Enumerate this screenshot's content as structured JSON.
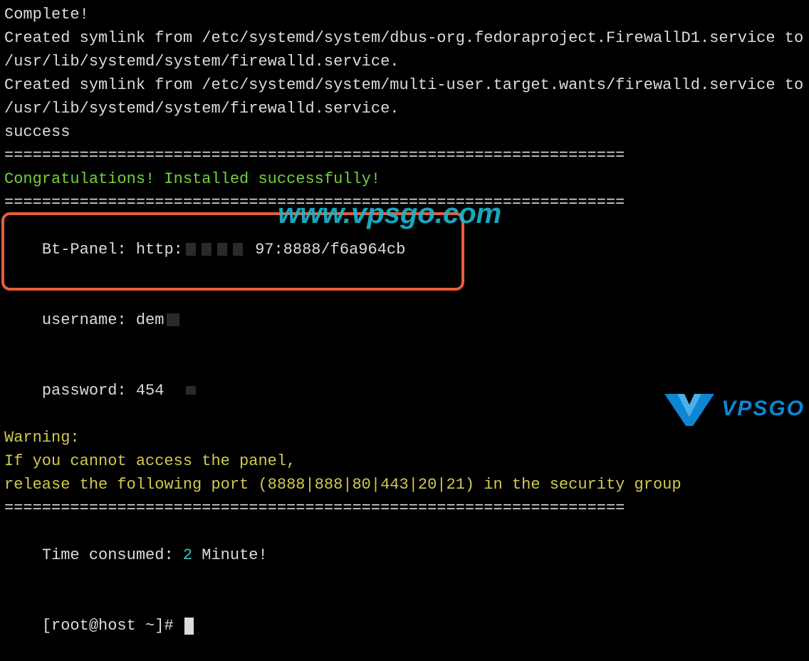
{
  "terminal": {
    "line_complete": "Complete!",
    "line_symlink1": "Created symlink from /etc/systemd/system/dbus-org.fedoraproject.FirewallD1.service to /usr/lib/systemd/system/firewalld.service.",
    "line_symlink2": "Created symlink from /etc/systemd/system/multi-user.target.wants/firewalld.service to /usr/lib/systemd/system/firewalld.service.",
    "line_success": "success",
    "divider1": "==================================================================",
    "congrats": "Congratulations! Installed successfully!",
    "divider2": "==================================================================",
    "panel_label": "Bt-Panel: http:",
    "panel_suffix": "97:8888/f6a964cb",
    "username_label": "username: dem",
    "password_label": "password: 454",
    "warning_title": "Warning:",
    "warning_line1": "If you cannot access the panel, ",
    "warning_line2": "release the following port (8888|888|80|443|20|21) in the security group",
    "divider3": "==================================================================",
    "time_prefix": "Time consumed: ",
    "time_value": "2",
    "time_suffix": " Minute!",
    "prompt": "[root@host ~]# "
  },
  "watermark": "www.vpsgo.com",
  "logo": {
    "text": "VPSGO"
  }
}
